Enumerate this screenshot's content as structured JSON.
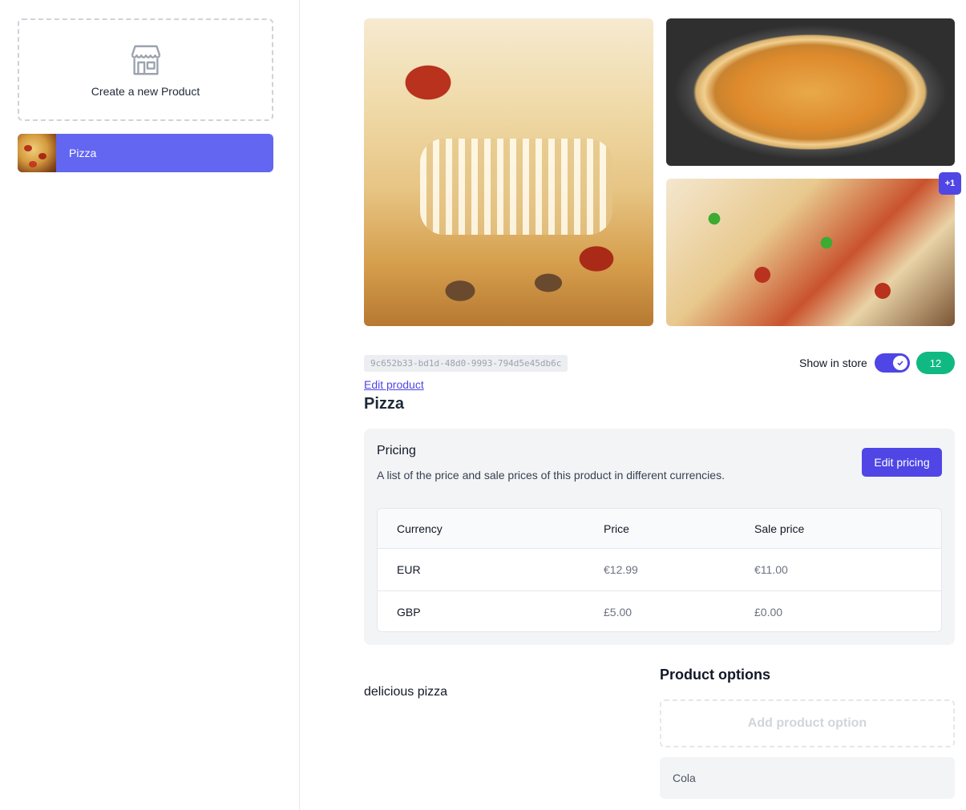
{
  "sidebar": {
    "create_label": "Create a new Product",
    "create_icon": "storefront-icon",
    "products": [
      {
        "name": "Pizza",
        "selected": true
      }
    ]
  },
  "gallery": {
    "more_count": "+1"
  },
  "product": {
    "id": "9c652b33-bd1d-48d0-9993-794d5e45db6c",
    "edit_label": "Edit product",
    "name": "Pizza",
    "show_in_store_label": "Show in store",
    "show_in_store": true,
    "stock": "12",
    "description": "delicious pizza"
  },
  "pricing": {
    "title": "Pricing",
    "description": "A list of the price and sale prices of this product in different currencies.",
    "edit_label": "Edit pricing",
    "columns": [
      "Currency",
      "Price",
      "Sale price"
    ],
    "rows": [
      [
        "EUR",
        "€12.99",
        "€11.00"
      ],
      [
        "GBP",
        "£5.00",
        "£0.00"
      ]
    ]
  },
  "options": {
    "title": "Product options",
    "add_label": "Add product option",
    "items": [
      "Cola"
    ]
  },
  "colors": {
    "accent": "#4f46e5",
    "selected_item": "#6366f1",
    "success": "#10b981"
  }
}
